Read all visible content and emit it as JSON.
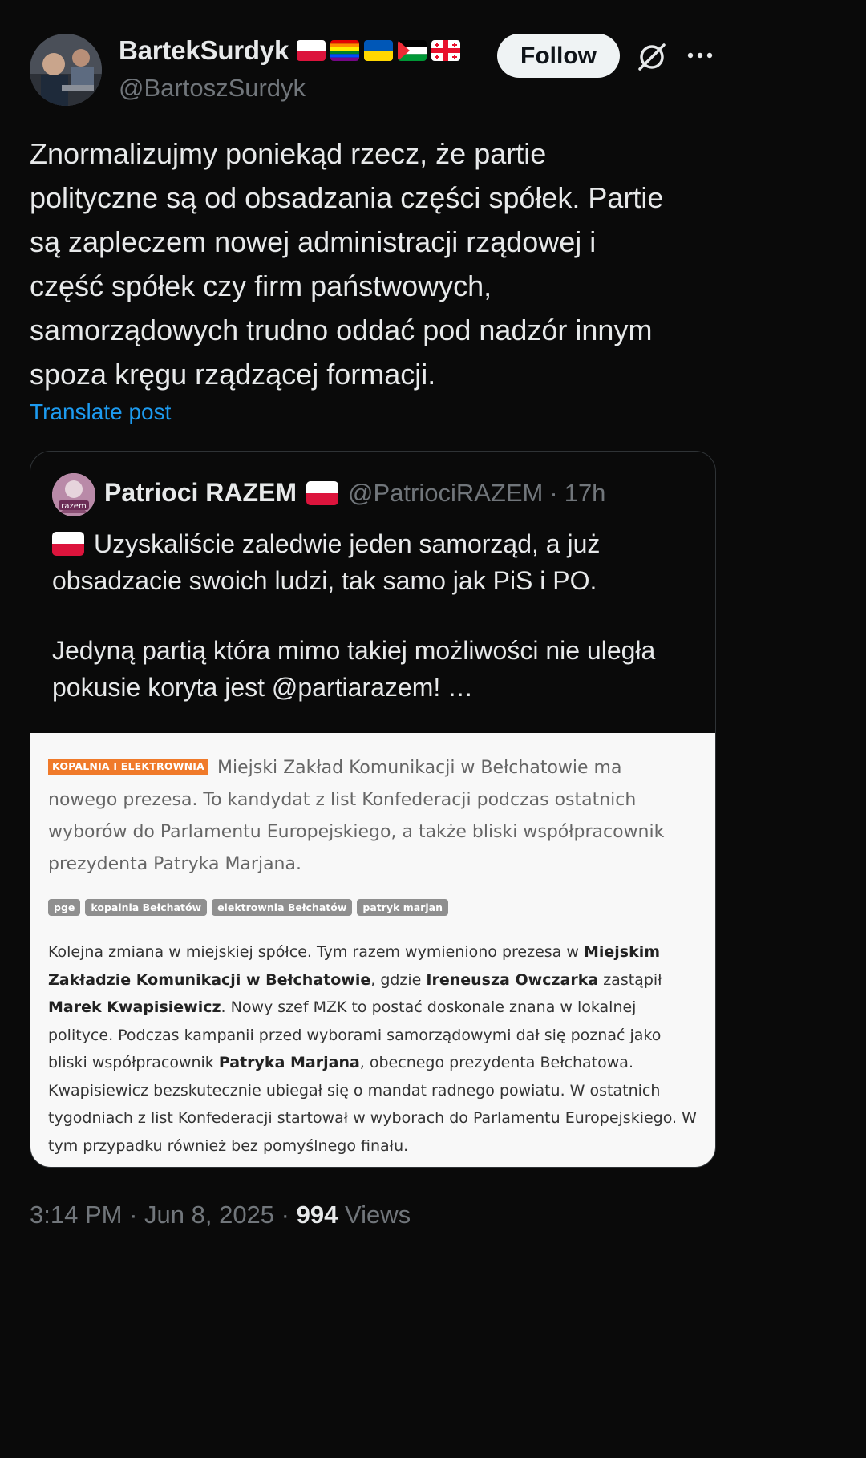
{
  "author": {
    "display_name": "BartekSurdyk",
    "handle": "@BartoszSurdyk",
    "flags": [
      "poland-flag",
      "rainbow-flag",
      "ukraine-flag",
      "palestine-flag",
      "georgia-flag"
    ]
  },
  "follow_label": "Follow",
  "post": {
    "text": "Znormalizujmy poniekąd rzecz, że partie\npolityczne są od obsadzania części spółek. Partie\nsą zapleczem nowej administracji rządowej i\nczęść spółek czy firm państwowych,\nsamorządowych trudno oddać pod nadzór innym\nspoza kręgu rządzącej formacji.",
    "translate_label": "Translate post"
  },
  "quote": {
    "display_name": "Patrioci RAZEM",
    "handle": "@PatriociRAZEM",
    "separator": "·",
    "time": "17h",
    "avatar_text": "razem",
    "line1": "Uzyskaliście zaledwie jeden samorząd, a już obsadzacie swoich ludzi, tak samo jak PiS i PO.",
    "line2": "Jedyną partią która mimo takiej możliwości nie uległa pokusie koryta jest @partiarazem!  …",
    "article": {
      "badge": "KOPALNIA I ELEKTROWNIA",
      "lead": "Miejski Zakład Komunikacji w Bełchatowie ma nowego prezesa. To kandydat z list Konfederacji podczas ostatnich wyborów do Parlamentu Europejskiego, a także bliski współpracownik prezydenta Patryka Marjana.",
      "tags": [
        "pge",
        "kopalnia Bełchatów",
        "elektrownia Bełchatów",
        "patryk marjan"
      ],
      "body": {
        "p1": "Kolejna zmiana w miejskiej spółce. Tym razem wymieniono prezesa w ",
        "b1": "Miejskim Zakładzie Komunikacji w Bełchatowie",
        "p2": ", gdzie ",
        "b2": "Ireneusza Owczarka",
        "p3": " zastąpił ",
        "b3": "Marek Kwapisiewicz",
        "p4": ". Nowy szef MZK to postać doskonale znana w lokalnej polityce. Podczas kampanii przed wyborami samorządowymi dał się poznać jako bliski współpracownik ",
        "b4": "Patryka Marjana",
        "p5": ", obecnego prezydenta Bełchatowa. Kwapisiewicz bezskutecznie ubiegał się o mandat radnego powiatu. W ostatnich tygodniach z list Konfederacji startował w wyborach do Parlamentu Europejskiego. W tym przypadku również bez pomyślnego finału."
      }
    }
  },
  "footer": {
    "time": "3:14 PM",
    "sep1": " · ",
    "date": "Jun 8, 2025",
    "sep2": " · ",
    "views_count": "994",
    "views_label": " Views"
  }
}
